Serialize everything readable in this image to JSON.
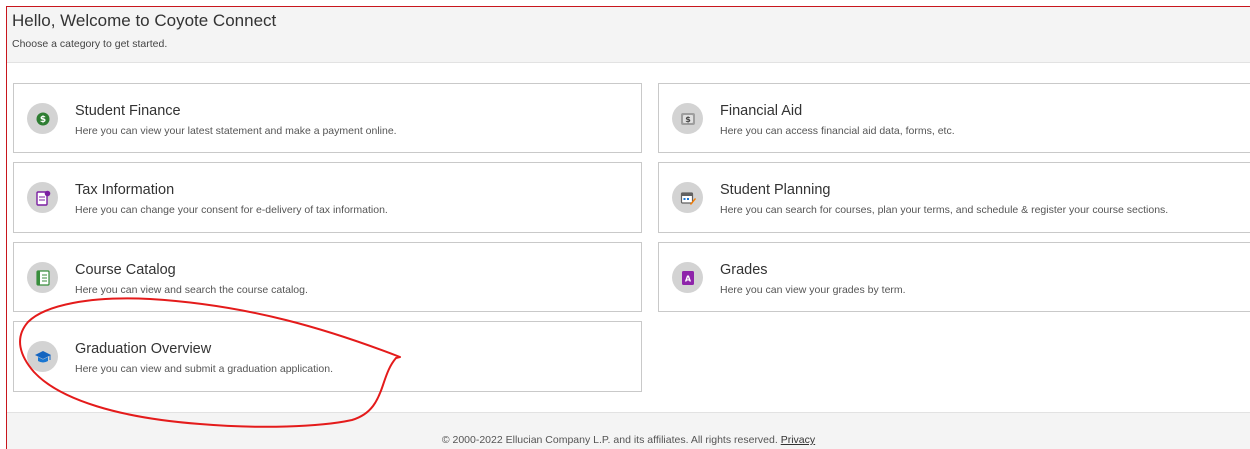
{
  "header": {
    "title": "Hello, Welcome to Coyote Connect",
    "subtitle": "Choose a category to get started."
  },
  "tiles": [
    {
      "title": "Student Finance",
      "description": "Here you can view your latest statement and make a payment online.",
      "icon": "money-icon"
    },
    {
      "title": "Financial Aid",
      "description": "Here you can access financial aid data, forms, etc.",
      "icon": "financial-aid-icon"
    },
    {
      "title": "Tax Information",
      "description": "Here you can change your consent for e-delivery of tax information.",
      "icon": "tax-document-icon"
    },
    {
      "title": "Student Planning",
      "description": "Here you can search for courses, plan your terms, and schedule & register your course sections.",
      "icon": "calendar-planning-icon"
    },
    {
      "title": "Course Catalog",
      "description": "Here you can view and search the course catalog.",
      "icon": "catalog-book-icon"
    },
    {
      "title": "Grades",
      "description": "Here you can view your grades by term.",
      "icon": "grades-icon"
    },
    {
      "title": "Graduation Overview",
      "description": "Here you can view and submit a graduation application.",
      "icon": "graduation-cap-icon"
    }
  ],
  "footer": {
    "copyright": "© 2000-2022 Ellucian Company L.P. and its affiliates. All rights reserved.",
    "privacy_link": "Privacy"
  },
  "colors": {
    "frame_border": "#c8161d",
    "annotation_stroke": "#e41b1b",
    "header_bg": "#f4f4f4",
    "tile_border": "#c9c9c9",
    "icon_circle": "#d3d3d3"
  }
}
